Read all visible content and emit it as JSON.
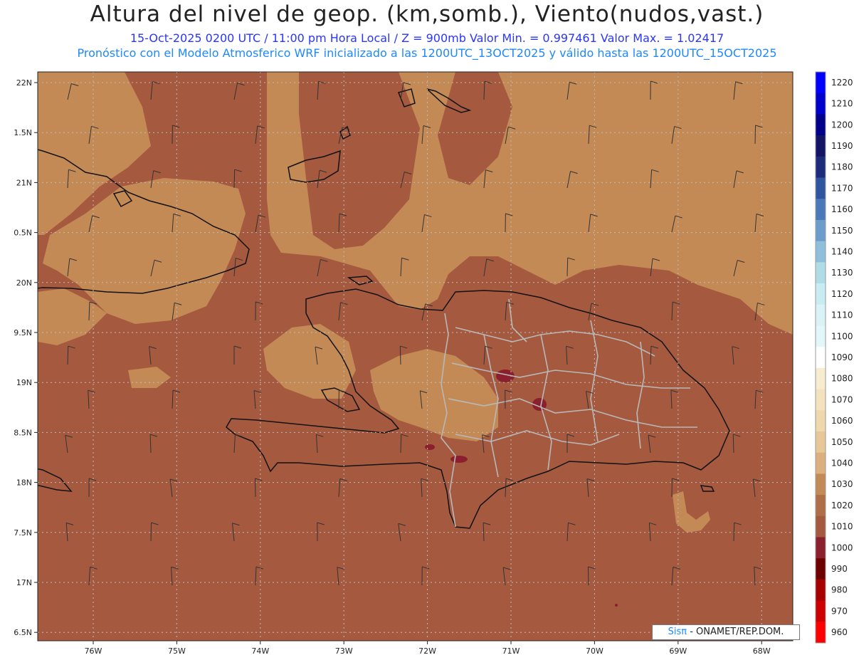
{
  "header": {
    "title": "Altura del nivel de geop. (km,somb.), Viento(nudos,vast.)",
    "line1": "15-Oct-2025  0200 UTC / 11:00 pm Hora Local / Z = 900mb   Valor Min. = 0.997461  Valor Max. = 1.02417",
    "line2": "Pronóstico con el Modelo Atmosferico WRF inicializado a las 1200UTC_13OCT2025 y válido hasta las  1200UTC_15OCT2025"
  },
  "map": {
    "lat_ticks": [
      "22N",
      "1.5N",
      "21N",
      "0.5N",
      "20N",
      "9.5N",
      "19N",
      "8.5N",
      "18N",
      "7.5N",
      "17N",
      "6.5N"
    ],
    "lon_ticks": [
      "76W",
      "75W",
      "74W",
      "73W",
      "72W",
      "71W",
      "70W",
      "69W",
      "68W"
    ],
    "colors": {
      "field_1010": "#a55a3f",
      "field_1020": "#c48a56",
      "field_1030": "#d8ad7c",
      "field_1000": "#8b1f2e",
      "coast": "#111111",
      "borders": "#b8b8b8"
    }
  },
  "colorbar": {
    "labels": [
      "1220",
      "1210",
      "1200",
      "1190",
      "1180",
      "1170",
      "1160",
      "1150",
      "1140",
      "1130",
      "1120",
      "1110",
      "1100",
      "1090",
      "1080",
      "1070",
      "1060",
      "1050",
      "1040",
      "1030",
      "1020",
      "1010",
      "1000",
      "990",
      "980",
      "970",
      "960"
    ],
    "colors": [
      "#0000ff",
      "#0000cc",
      "#00008b",
      "#141466",
      "#1e2a7a",
      "#2f55a0",
      "#4a78b8",
      "#6a9ccc",
      "#8ec0dc",
      "#b0dce8",
      "#c8ecf2",
      "#d8f2f6",
      "#e2f7fa",
      "#ffffff",
      "#f7ecd0",
      "#f3e2bd",
      "#efd8ab",
      "#e7c796",
      "#dbb07c",
      "#c48a56",
      "#b06e47",
      "#a55a3f",
      "#8b1f2e",
      "#6e0000",
      "#a80000",
      "#cc0000",
      "#ff0000"
    ]
  },
  "credit": {
    "logo": "Sisπ",
    "text": " - ONAMET/REP.DOM."
  }
}
